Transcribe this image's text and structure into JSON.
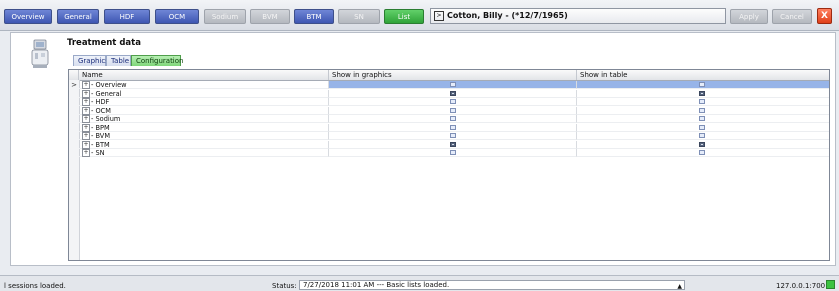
{
  "toolbar": {
    "buttons": [
      {
        "label": "Overview",
        "style": "blue"
      },
      {
        "label": "General",
        "style": "blue"
      },
      {
        "label": "HDF",
        "style": "blue"
      },
      {
        "label": "OCM",
        "style": "blue"
      },
      {
        "label": "Sodium",
        "style": "grey"
      },
      {
        "label": "BVM",
        "style": "grey"
      },
      {
        "label": "BTM",
        "style": "blue"
      },
      {
        "label": "SN",
        "style": "grey"
      },
      {
        "label": "List",
        "style": "green"
      }
    ],
    "patient": "Cotton, Billy - (*12/7/1965)",
    "apply_label": "Apply",
    "cancel_label": "Cancel",
    "close_label": "X"
  },
  "panel": {
    "title": "Treatment data",
    "tabs": [
      {
        "label": "Graphics",
        "active": false
      },
      {
        "label": "Table",
        "active": false
      },
      {
        "label": "Configuration",
        "active": true
      }
    ]
  },
  "grid": {
    "columns": [
      "Name",
      "Show in graphics",
      "Show in table"
    ],
    "rows": [
      {
        "name": "Overview",
        "graphics": false,
        "table": false,
        "selected": true
      },
      {
        "name": "General",
        "graphics": true,
        "table": true,
        "selected": false
      },
      {
        "name": "HDF",
        "graphics": false,
        "table": false,
        "selected": false
      },
      {
        "name": "OCM",
        "graphics": false,
        "table": false,
        "selected": false
      },
      {
        "name": "Sodium",
        "graphics": false,
        "table": false,
        "selected": false
      },
      {
        "name": "BPM",
        "graphics": false,
        "table": false,
        "selected": false
      },
      {
        "name": "BVM",
        "graphics": false,
        "table": false,
        "selected": false
      },
      {
        "name": "BTM",
        "graphics": true,
        "table": true,
        "selected": false
      },
      {
        "name": "SN",
        "graphics": false,
        "table": false,
        "selected": false
      }
    ]
  },
  "statusbar": {
    "left": "l sessions loaded.",
    "status_label": "Status:",
    "status_value": "7/27/2018 11:01 AM --- Basic lists loaded.",
    "ip": "127.0.0.1:700"
  },
  "colors": {
    "toolbar_blue": "#3e56b2",
    "list_green": "#2fa338",
    "selection": "#97b4e8",
    "close_red": "#e0401a"
  }
}
